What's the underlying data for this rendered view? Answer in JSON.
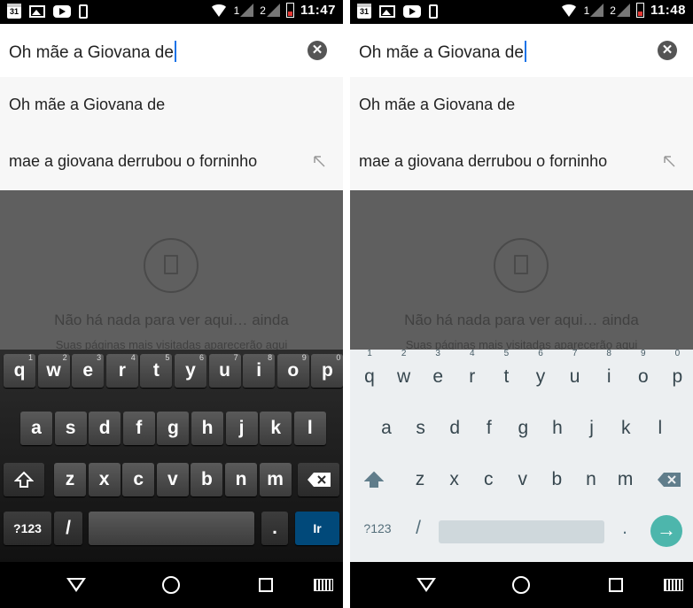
{
  "screens": [
    {
      "status": {
        "time": "11:47",
        "calendar_day": "31",
        "sim1": "1",
        "sim2": "2"
      },
      "search": {
        "text": "Oh mãe a Giovana de"
      },
      "suggestions": [
        {
          "text": "Oh mãe a Giovana de"
        },
        {
          "text": "mae a giovana derrubou o forninho"
        }
      ],
      "empty": {
        "title": "Não há nada para ver aqui… ainda",
        "subtitle": "Suas páginas mais visitadas aparecerão aqui"
      },
      "keyboard": {
        "style": "dark",
        "row1": [
          "q",
          "w",
          "e",
          "r",
          "t",
          "y",
          "u",
          "i",
          "o",
          "p"
        ],
        "row1_hints": [
          "1",
          "2",
          "3",
          "4",
          "5",
          "6",
          "7",
          "8",
          "9",
          "0"
        ],
        "row2": [
          "a",
          "s",
          "d",
          "f",
          "g",
          "h",
          "j",
          "k",
          "l"
        ],
        "row3": [
          "z",
          "x",
          "c",
          "v",
          "b",
          "n",
          "m"
        ],
        "symbols_label": "?123",
        "slash_label": "/",
        "period_label": ".",
        "go_label": "Ir"
      }
    },
    {
      "status": {
        "time": "11:48",
        "calendar_day": "31",
        "sim1": "1",
        "sim2": "2"
      },
      "search": {
        "text": "Oh mãe a Giovana de"
      },
      "suggestions": [
        {
          "text": "Oh mãe a Giovana de"
        },
        {
          "text": "mae a giovana derrubou o forninho"
        }
      ],
      "empty": {
        "title": "Não há nada para ver aqui… ainda",
        "subtitle": "Suas páginas mais visitadas aparecerão aqui"
      },
      "keyboard": {
        "style": "light",
        "row1": [
          "q",
          "w",
          "e",
          "r",
          "t",
          "y",
          "u",
          "i",
          "o",
          "p"
        ],
        "row1_hints": [
          "1",
          "2",
          "3",
          "4",
          "5",
          "6",
          "7",
          "8",
          "9",
          "0"
        ],
        "row2": [
          "a",
          "s",
          "d",
          "f",
          "g",
          "h",
          "j",
          "k",
          "l"
        ],
        "row3": [
          "z",
          "x",
          "c",
          "v",
          "b",
          "n",
          "m"
        ],
        "symbols_label": "?123",
        "slash_label": "/",
        "period_label": ".",
        "go_label": "→"
      }
    }
  ],
  "colors": {
    "cursor": "#1a73e8",
    "dim_overlay": "#5f5f5f",
    "dark_go_key": "#01497a",
    "light_go_key": "#4db6ac",
    "light_keyboard_bg": "#eceff1"
  },
  "icons": {
    "status_left": [
      "calendar-icon",
      "image-icon",
      "youtube-icon",
      "phone-icon"
    ],
    "status_right": [
      "wifi-icon",
      "signal-icon",
      "signal-icon",
      "battery-icon"
    ],
    "clear": "close-circle-icon",
    "suggestion_action": "arrow-up-left-icon",
    "empty_state": "document-circle-icon",
    "shift": "shift-arrow-icon",
    "backspace": "backspace-icon",
    "nav": [
      "back-triangle-icon",
      "home-circle-icon",
      "recent-square-icon",
      "keyboard-icon"
    ]
  }
}
